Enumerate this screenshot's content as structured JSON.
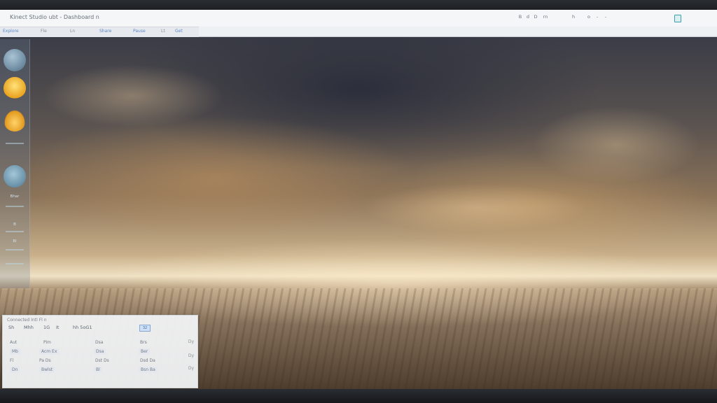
{
  "window": {
    "title": "Kinect Studio ubt - Dashboard n"
  },
  "topbar": {
    "right_items": [
      "B",
      "d",
      "D",
      "rn",
      "h",
      "o",
      "-",
      "-"
    ],
    "toolbar": [
      {
        "label": "Explore",
        "kind": "link"
      },
      {
        "label": "Fle",
        "kind": "gray"
      },
      {
        "label": "Ln",
        "kind": "gray"
      },
      {
        "label": "Share",
        "kind": "link"
      },
      {
        "label": "Pause",
        "kind": "link"
      },
      {
        "label": "Lt",
        "kind": "gray"
      },
      {
        "label": "Get",
        "kind": "link"
      }
    ]
  },
  "dock": {
    "items": [
      {
        "label": "",
        "icon": "globe-icon",
        "color": "#6f8fa6"
      },
      {
        "label": "",
        "icon": "sun-icon",
        "color": "#f0b52e"
      },
      {
        "label": "",
        "icon": "cloud-sun-icon",
        "color": "#e8a72a"
      },
      {
        "label": "Bhar",
        "icon": "weather-icon",
        "color": "#6e9bb3"
      },
      {
        "label": "B",
        "icon": "chart-icon",
        "color": "#6a93b0"
      },
      {
        "label": "Bl",
        "icon": "list-icon",
        "color": "#6a93b0"
      }
    ]
  },
  "panel": {
    "title": "Connected Intl Fl n",
    "toolbar": [
      "Sh",
      "Mhh",
      "1G",
      "It",
      "hh 5oG1"
    ],
    "badge": "32",
    "rows": [
      [
        "Aut",
        "Pim",
        "Dsa",
        "Brs"
      ],
      [
        "Mb",
        "Acm Ex",
        "Dsa",
        "Ber"
      ],
      [
        "Fl",
        "Pa Ds",
        "Dst Ds",
        "Dsd Da"
      ],
      [
        "Dn",
        "Bwlst",
        "Bl",
        "Bsn Ba"
      ]
    ],
    "side": [
      "Dy",
      "Dy",
      "Dy"
    ]
  },
  "colors": {
    "accent": "#5b88c4",
    "topbar_bg": "#eef1f4",
    "panel_bg": "#f4f6f9"
  }
}
